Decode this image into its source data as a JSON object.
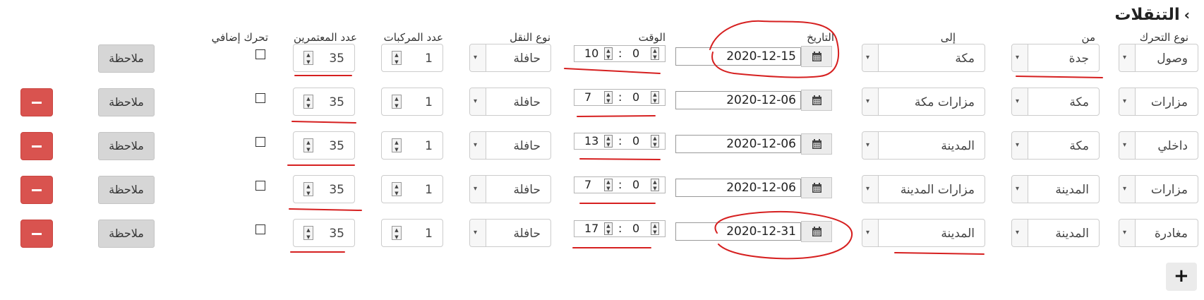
{
  "page": {
    "title": "التنقلات",
    "back_icon": "chevron-icon"
  },
  "headers": {
    "move_type": "نوع التحرك",
    "from": "من",
    "to": "إلى",
    "date": "التاريخ",
    "time": "الوقت",
    "transport": "نوع النقل",
    "vehicles": "عدد المركبات",
    "pilgrims": "عدد المعتمرين",
    "extra": "تحرك إضافي"
  },
  "rows": [
    {
      "move_type": "وصول",
      "from": "جدة",
      "to": "مكة",
      "date": "2020-12-15",
      "hour": "10",
      "minute": "0",
      "transport": "حافلة",
      "vehicles": "1",
      "pilgrims": "35",
      "note": "ملاحظة"
    },
    {
      "move_type": "مزارات",
      "from": "مكة",
      "to": "مزارات مكة",
      "date": "2020-12-06",
      "hour": "7",
      "minute": "0",
      "transport": "حافلة",
      "vehicles": "1",
      "pilgrims": "35",
      "note": "ملاحظة"
    },
    {
      "move_type": "داخلي",
      "from": "مكة",
      "to": "المدينة",
      "date": "2020-12-06",
      "hour": "13",
      "minute": "0",
      "transport": "حافلة",
      "vehicles": "1",
      "pilgrims": "35",
      "note": "ملاحظة"
    },
    {
      "move_type": "مزارات",
      "from": "المدينة",
      "to": "مزارات المدينة",
      "date": "2020-12-06",
      "hour": "7",
      "minute": "0",
      "transport": "حافلة",
      "vehicles": "1",
      "pilgrims": "35",
      "note": "ملاحظة"
    },
    {
      "move_type": "مغادرة",
      "from": "المدينة",
      "to": "المدينة",
      "date": "2020-12-31",
      "hour": "17",
      "minute": "0",
      "transport": "حافلة",
      "vehicles": "1",
      "pilgrims": "35",
      "note": "ملاحظة"
    }
  ],
  "time_separator": ":",
  "add_button_label": "+",
  "colors": {
    "delete": "#d9534f",
    "annotation": "#d62020",
    "note_button": "#d6d6d6"
  }
}
